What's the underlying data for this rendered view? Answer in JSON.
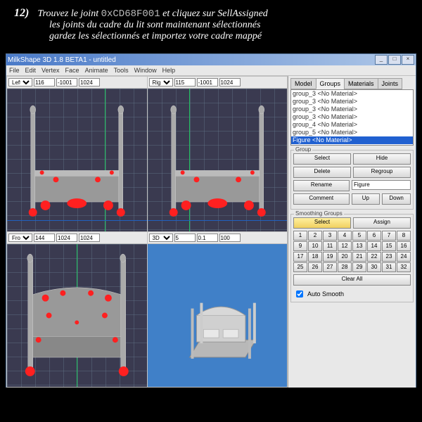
{
  "instruction": {
    "step": "12)",
    "line1a": "Trouvez le joint ",
    "code": "0xCD68F001",
    "line1b": " et cliquez sur SellAssigned",
    "line2": "les joints du cadre du lit sont maintenant sélectionnés",
    "line3": "gardez les sélectionnés et importez votre cadre mappé"
  },
  "window": {
    "title": "MilkShape 3D 1.8 BETA1 - untitled",
    "menus": [
      "File",
      "Edit",
      "Vertex",
      "Face",
      "Animate",
      "Tools",
      "Window",
      "Help"
    ],
    "title_btns": [
      "_",
      "□",
      "×"
    ]
  },
  "vp_top_left": {
    "label": "Left",
    "a": "116",
    "b": "-1001",
    "c": "1024"
  },
  "vp_top_right": {
    "label": "Right",
    "a": "115",
    "b": "-1001",
    "c": "1024"
  },
  "vp_bot_left": {
    "label": "Front",
    "a": "144",
    "b": "1024",
    "c": "1024"
  },
  "vp_bot_right": {
    "label": "3D",
    "a": "5",
    "b": "0.1",
    "c": "100"
  },
  "tabs": {
    "model": "Model",
    "groups": "Groups",
    "materials": "Materials",
    "joints": "Joints"
  },
  "list_items": [
    "group_3 <No Material>",
    "group_3 <No Material>",
    "group_3 <No Material>",
    "group_3 <No Material>",
    "group_4 <No Material>",
    "group_5 <No Material>",
    "Figure <No Material>"
  ],
  "group_panel": {
    "legend": "Group",
    "select": "Select",
    "hide": "Hide",
    "delete": "Delete",
    "regroup": "Regroup",
    "rename": "Rename",
    "rename_val": "Figure",
    "comment": "Comment",
    "up": "Up",
    "down": "Down"
  },
  "sg_panel": {
    "legend": "Smoothing Groups",
    "select": "Select",
    "assign": "Assign",
    "clear": "Clear All",
    "auto": "Auto Smooth"
  }
}
